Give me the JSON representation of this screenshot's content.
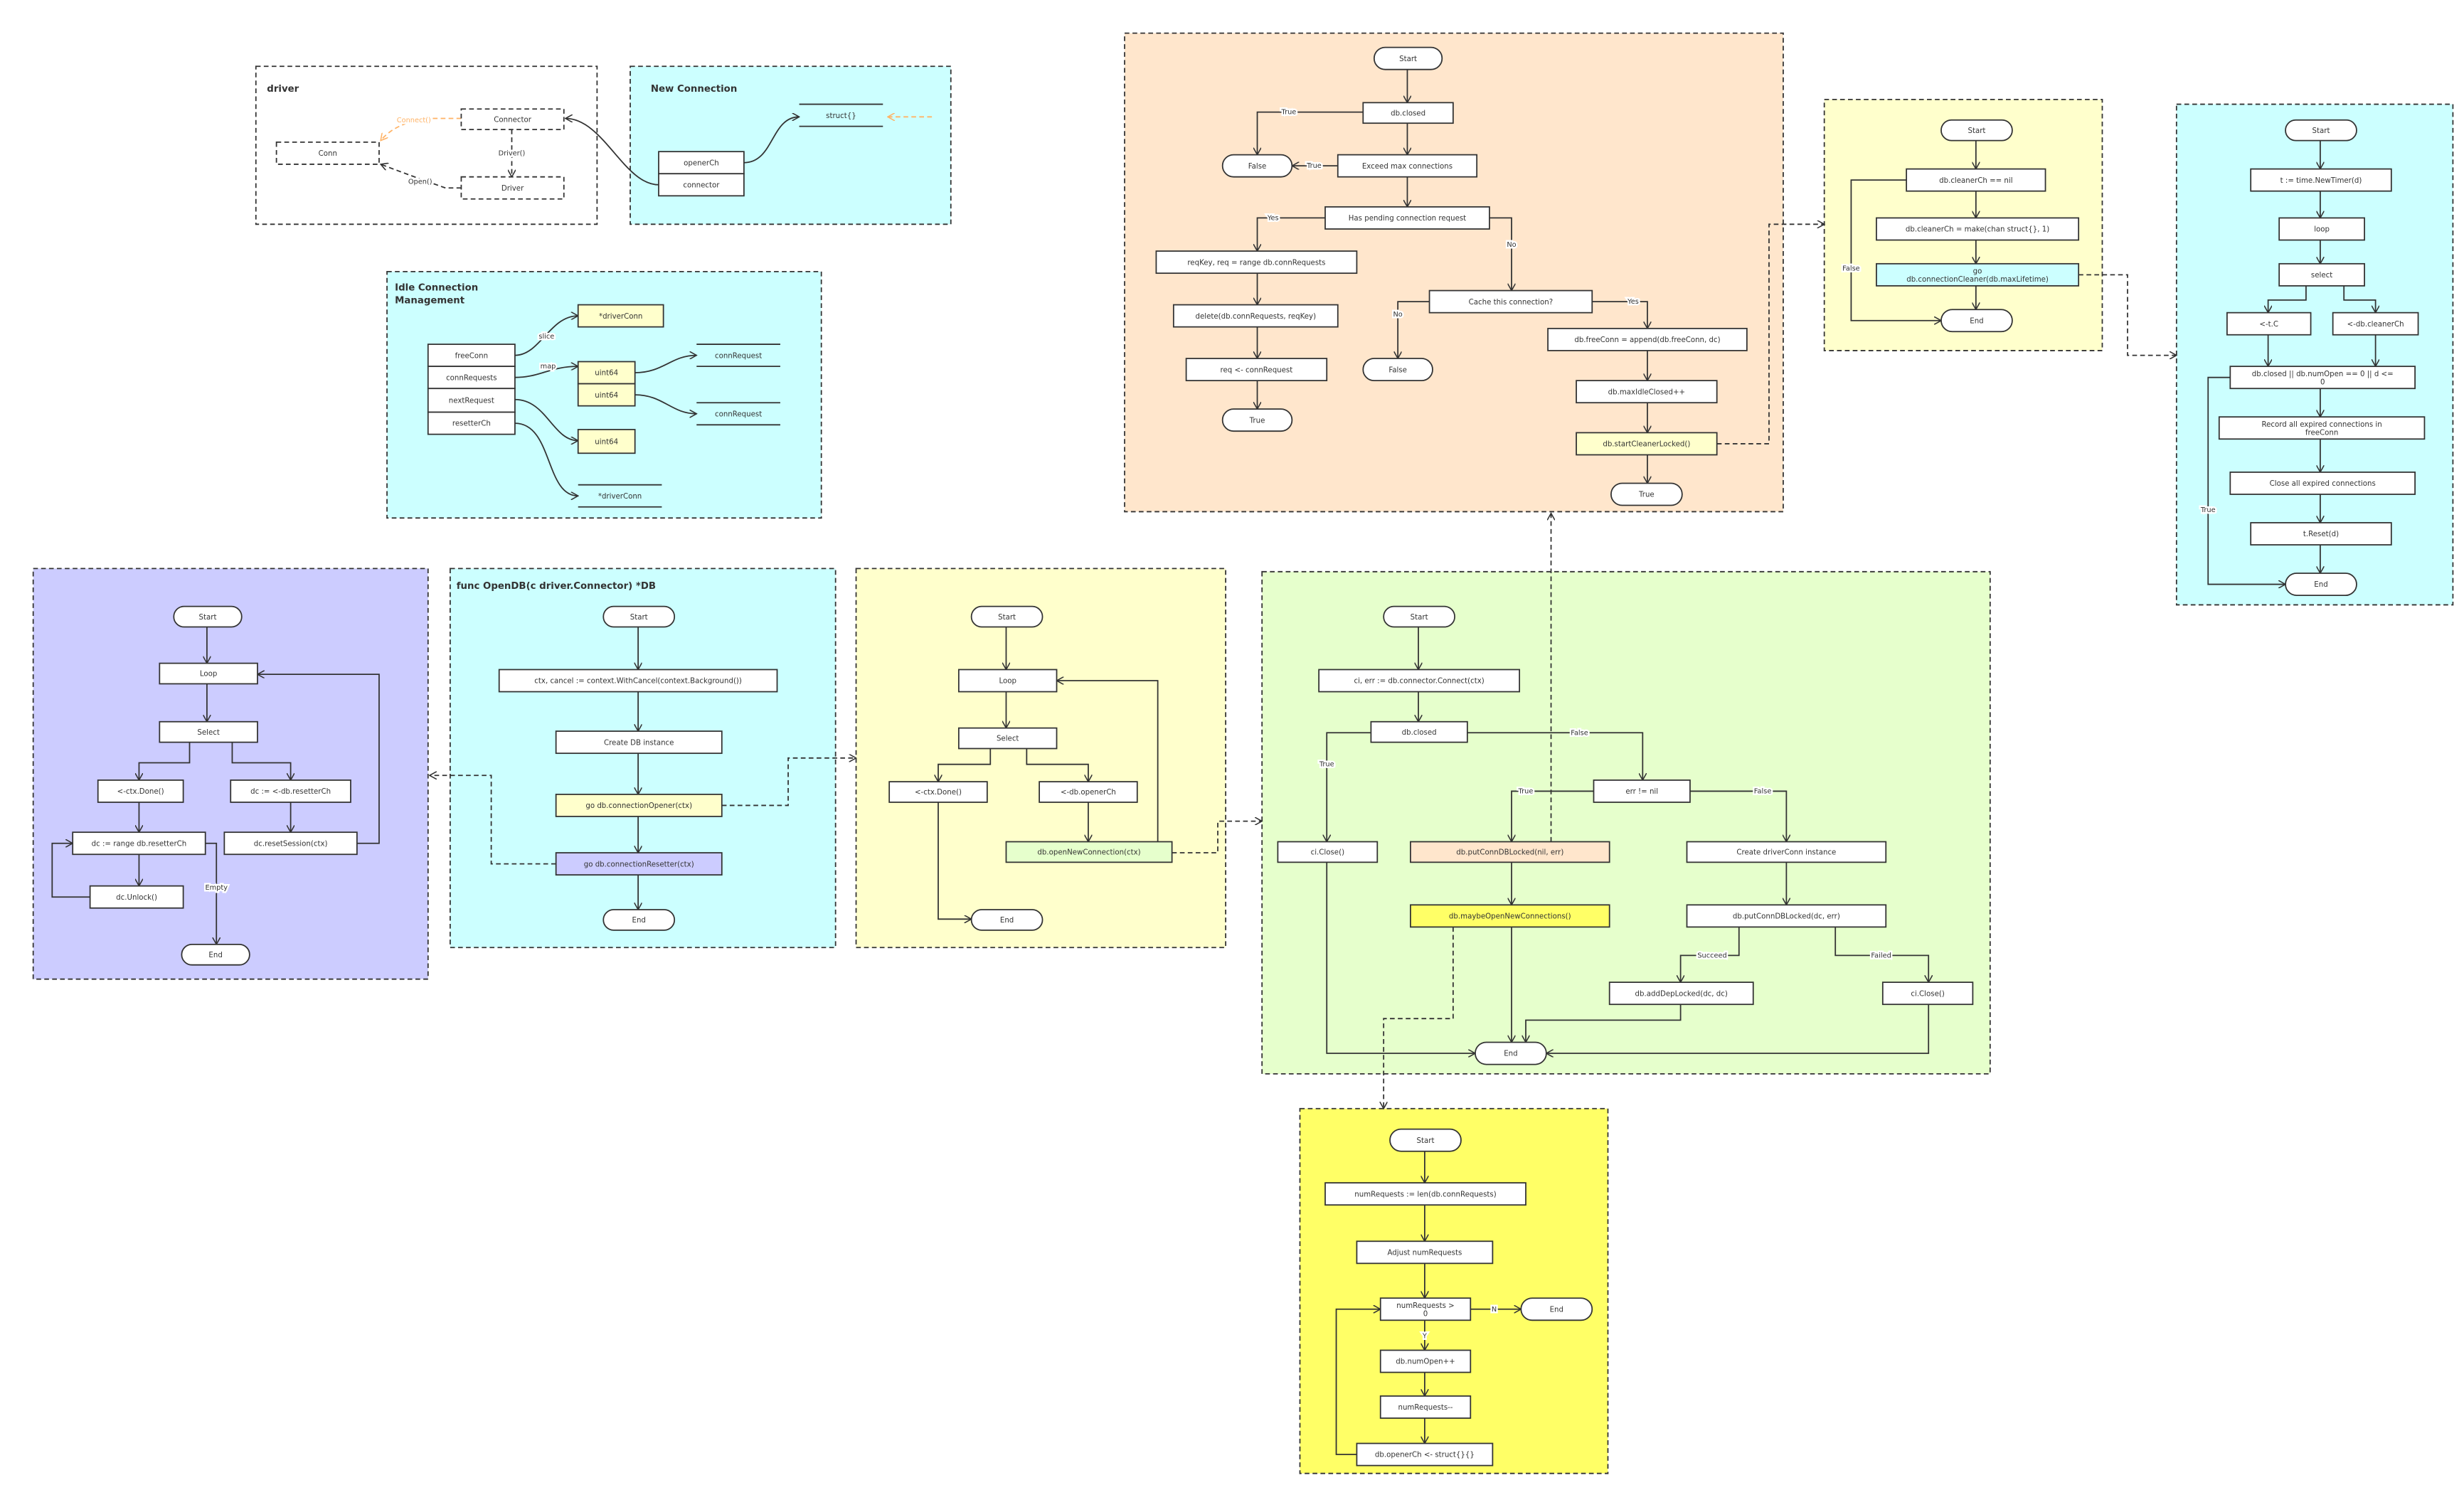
{
  "colors": {
    "orange_panel": "#ffe6cc",
    "light_yellow": "#ffffcc",
    "cyan": "#ccffff",
    "lavender": "#ccccff",
    "light_green": "#e6ffcc",
    "bright_yellow": "#ffff66",
    "connect_arrow": "#ffb366",
    "stroke": "#333333"
  },
  "panels": {
    "driver": "driver",
    "new_connection": "New Connection",
    "idle": [
      "Idle Connection",
      "Management"
    ],
    "open_db": "func OpenDB(c driver.Connector) *DB"
  },
  "nodes": {
    "drv_connector": "Connector",
    "drv_conn": "Conn",
    "drv_driver": "Driver",
    "nc_openerch": "openerCh",
    "nc_connector": "connector",
    "nc_struct": "struct{}",
    "idle_freeconn": "freeConn",
    "idle_connrequests": "connRequests",
    "idle_nextrequest": "nextRequest",
    "idle_resetterch": "resetterCh",
    "idle_driverconn1": "*driverConn",
    "idle_uint64_1": "uint64",
    "idle_uint64_2": "uint64",
    "idle_uint64_3": "uint64",
    "idle_connrequest1": "connRequest",
    "idle_connrequest2": "connRequest",
    "idle_driverconn2": "*driverConn",
    "pc_start": "Start",
    "pc_closed": "db.closed",
    "pc_false1": "False",
    "pc_exceed": "Exceed max connections",
    "pc_pending": "Has pending connection request",
    "pc_reqkey": "reqKey, req = range db.connRequests",
    "pc_delete": "delete(db.connRequests, reqKey)",
    "pc_req": "req <- connRequest",
    "pc_true1": "True",
    "pc_cache": "Cache this connection?",
    "pc_false2": "False",
    "pc_append": "db.freeConn = append(db.freeConn, dc)",
    "pc_maxidle": "db.maxIdleClosed++",
    "pc_startcleaner": "db.startCleanerLocked()",
    "pc_true2": "True",
    "cl_start": "Start",
    "cl_nil": "db.cleanerCh == nil",
    "cl_make": "db.cleanerCh = make(chan struct{}, 1)",
    "cl_go": [
      "go",
      "db.connectionCleaner(db.maxLifetime)"
    ],
    "cl_end": "End",
    "cc_start": "Start",
    "cc_timer": "t := time.NewTimer(d)",
    "cc_loop": "loop",
    "cc_select": "select",
    "cc_tc": "<-t.C",
    "cc_cleanerch": "<-db.cleanerCh",
    "cc_cond": [
      "db.closed || db.numOpen == 0 || d <=",
      "0"
    ],
    "cc_record": [
      "Record all expired connections in",
      "freeConn"
    ],
    "cc_close": "Close all expired connections",
    "cc_reset": "t.Reset(d)",
    "cc_end": "End",
    "rs_start": "Start",
    "rs_loop": "Loop",
    "rs_select": "Select",
    "rs_done": "<-ctx.Done()",
    "rs_recv": "dc := <-db.resetterCh",
    "rs_range": "dc := range db.resetterCh",
    "rs_reset": "dc.resetSession(ctx)",
    "rs_unlock": "dc.Unlock()",
    "rs_end": "End",
    "od_start": "Start",
    "od_ctx": "ctx, cancel := context.WithCancel(context.Background())",
    "od_create": "Create DB instance",
    "od_opener": "go db.connectionOpener(ctx)",
    "od_resetter": "go db.connectionResetter(ctx)",
    "od_end": "End",
    "op_start": "Start",
    "op_loop": "Loop",
    "op_select": "Select",
    "op_done": "<-ctx.Done()",
    "op_openerch": "<-db.openerCh",
    "op_opennew": "db.openNewConnection(ctx)",
    "op_end": "End",
    "onc_start": "Start",
    "onc_connect": "ci, err := db.connector.Connect(ctx)",
    "onc_closed": "db.closed",
    "onc_close1": "ci.Close()",
    "onc_err": "err != nil",
    "onc_putnil": "db.putConnDBLocked(nil, err)",
    "onc_maybe": "db.maybeOpenNewConnections()",
    "onc_create": "Create driverConn instance",
    "onc_putdc": "db.putConnDBLocked(dc, err)",
    "onc_adddep": "db.addDepLocked(dc, dc)",
    "onc_close2": "ci.Close()",
    "onc_end": "End",
    "mo_start": "Start",
    "mo_len": "numRequests := len(db.connRequests)",
    "mo_adjust": "Adjust numRequests",
    "mo_cond": [
      "numRequests >",
      "0"
    ],
    "mo_end": "End",
    "mo_numopen": "db.numOpen++",
    "mo_dec": "numRequests--",
    "mo_send": "db.openerCh <- struct{}{}"
  },
  "edge_labels": {
    "drv_connect": "Connect()",
    "drv_driver": "Driver()",
    "drv_open": "Open()",
    "idle_slice": "slice",
    "idle_map": "map",
    "pc_true_closed": "True",
    "pc_true_exceed": "True",
    "pc_yes_pending": "Yes",
    "pc_no_pending": "No",
    "pc_no_cache": "No",
    "pc_yes_cache": "Yes",
    "cl_false": "False",
    "cc_true": "True",
    "rs_empty": "Empty",
    "onc_false_closed": "False",
    "onc_true_closed": "True",
    "onc_true_err": "True",
    "onc_false_err": "False",
    "onc_succeed": "Succeed",
    "onc_failed": "Failed",
    "mo_n": "N",
    "mo_y": "Y"
  }
}
